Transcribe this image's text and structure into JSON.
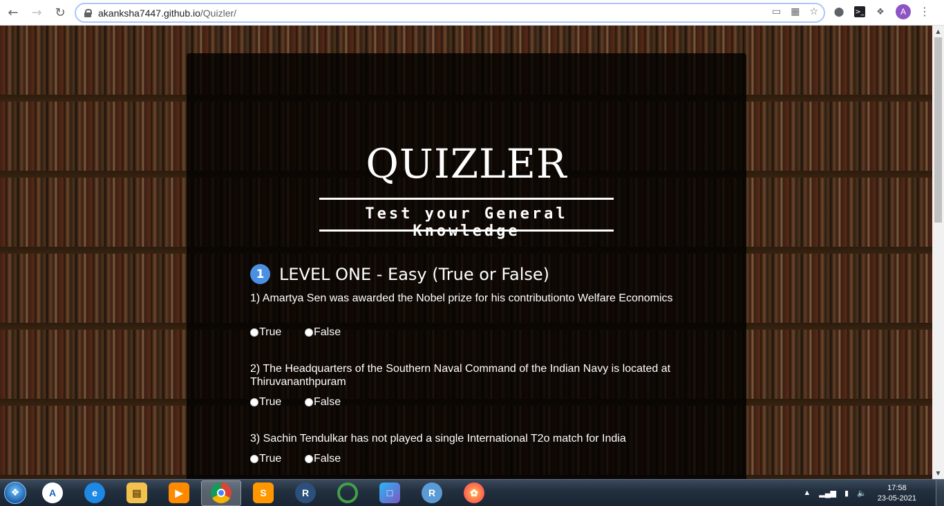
{
  "browser": {
    "url_host": "akanksha7447.github.io",
    "url_path": "/Quizler/",
    "profile_initial": "A",
    "icons": [
      "back-icon",
      "forward-icon",
      "reload-icon",
      "lock-icon",
      "cast-icon",
      "qr-icon",
      "star-icon",
      "extension-circle-icon",
      "terminal-icon",
      "puzzle-icon",
      "menu-icon"
    ]
  },
  "page": {
    "logo": "QUIZLER",
    "tagline": "Test your General Knowledge",
    "level_number": "1",
    "level_title": "LEVEL ONE - Easy (True or False)",
    "questions": [
      {
        "text": "1) Amartya Sen was awarded the Nobel prize for his contributionto Welfare Economics",
        "options": [
          "True",
          "False"
        ]
      },
      {
        "text": "2) The Headquarters of the Southern Naval Command of the Indian Navy is located at Thiruvananthpuram",
        "options": [
          "True",
          "False"
        ]
      },
      {
        "text": "3) Sachin Tendulkar has not played a single International T2o match for India",
        "options": [
          "True",
          "False"
        ]
      }
    ]
  },
  "taskbar": {
    "apps": [
      "windows-start",
      "autodesk",
      "internet-explorer",
      "file-explorer",
      "media-player",
      "chrome",
      "sublime-text",
      "r-studio",
      "cycle-app",
      "virtualbox",
      "r-app",
      "firefox"
    ],
    "time": "17:58",
    "date": "23-05-2021"
  },
  "colors": {
    "level_badge": "#4a90e2",
    "panel_bg": "rgba(0,0,0,0.78)",
    "avatar": "#8e53c5"
  }
}
